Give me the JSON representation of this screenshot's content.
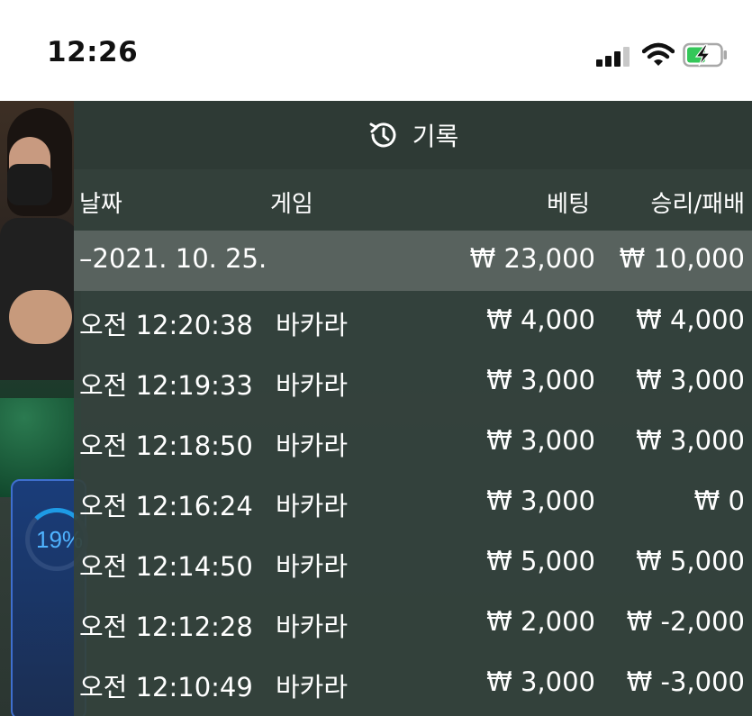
{
  "status_bar": {
    "time": "12:26"
  },
  "game": {
    "progress_label": "19%"
  },
  "history": {
    "title": "기록",
    "columns": {
      "date": "날짜",
      "game": "게임",
      "bet": "베팅",
      "result": "승리/패배"
    },
    "date_group": {
      "label": "–2021. 10. 25.",
      "bet_total": "₩ 23,000",
      "result_total": "₩ 10,000"
    },
    "rows": [
      {
        "time": "오전 12:20:38",
        "game": "바카라",
        "bet": "₩ 4,000",
        "result": "₩ 4,000"
      },
      {
        "time": "오전 12:19:33",
        "game": "바카라",
        "bet": "₩ 3,000",
        "result": "₩ 3,000"
      },
      {
        "time": "오전 12:18:50",
        "game": "바카라",
        "bet": "₩ 3,000",
        "result": "₩ 3,000"
      },
      {
        "time": "오전 12:16:24",
        "game": "바카라",
        "bet": "₩ 3,000",
        "result": "₩ 0"
      },
      {
        "time": "오전 12:14:50",
        "game": "바카라",
        "bet": "₩ 5,000",
        "result": "₩ 5,000"
      },
      {
        "time": "오전 12:12:28",
        "game": "바카라",
        "bet": "₩ 2,000",
        "result": "₩ -2,000"
      },
      {
        "time": "오전 12:10:49",
        "game": "바카라",
        "bet": "₩ 3,000",
        "result": "₩ -3,000"
      }
    ]
  },
  "icons": {
    "history": "history-clock-icon",
    "signal": "cellular-signal-icon",
    "wifi": "wifi-icon",
    "battery": "battery-charging-icon"
  },
  "colors": {
    "panel_bg": "#34423c",
    "header_bg": "#2e3a35",
    "date_row_bg": "#58625e",
    "text": "#ffffff",
    "battery_green": "#34c759"
  }
}
